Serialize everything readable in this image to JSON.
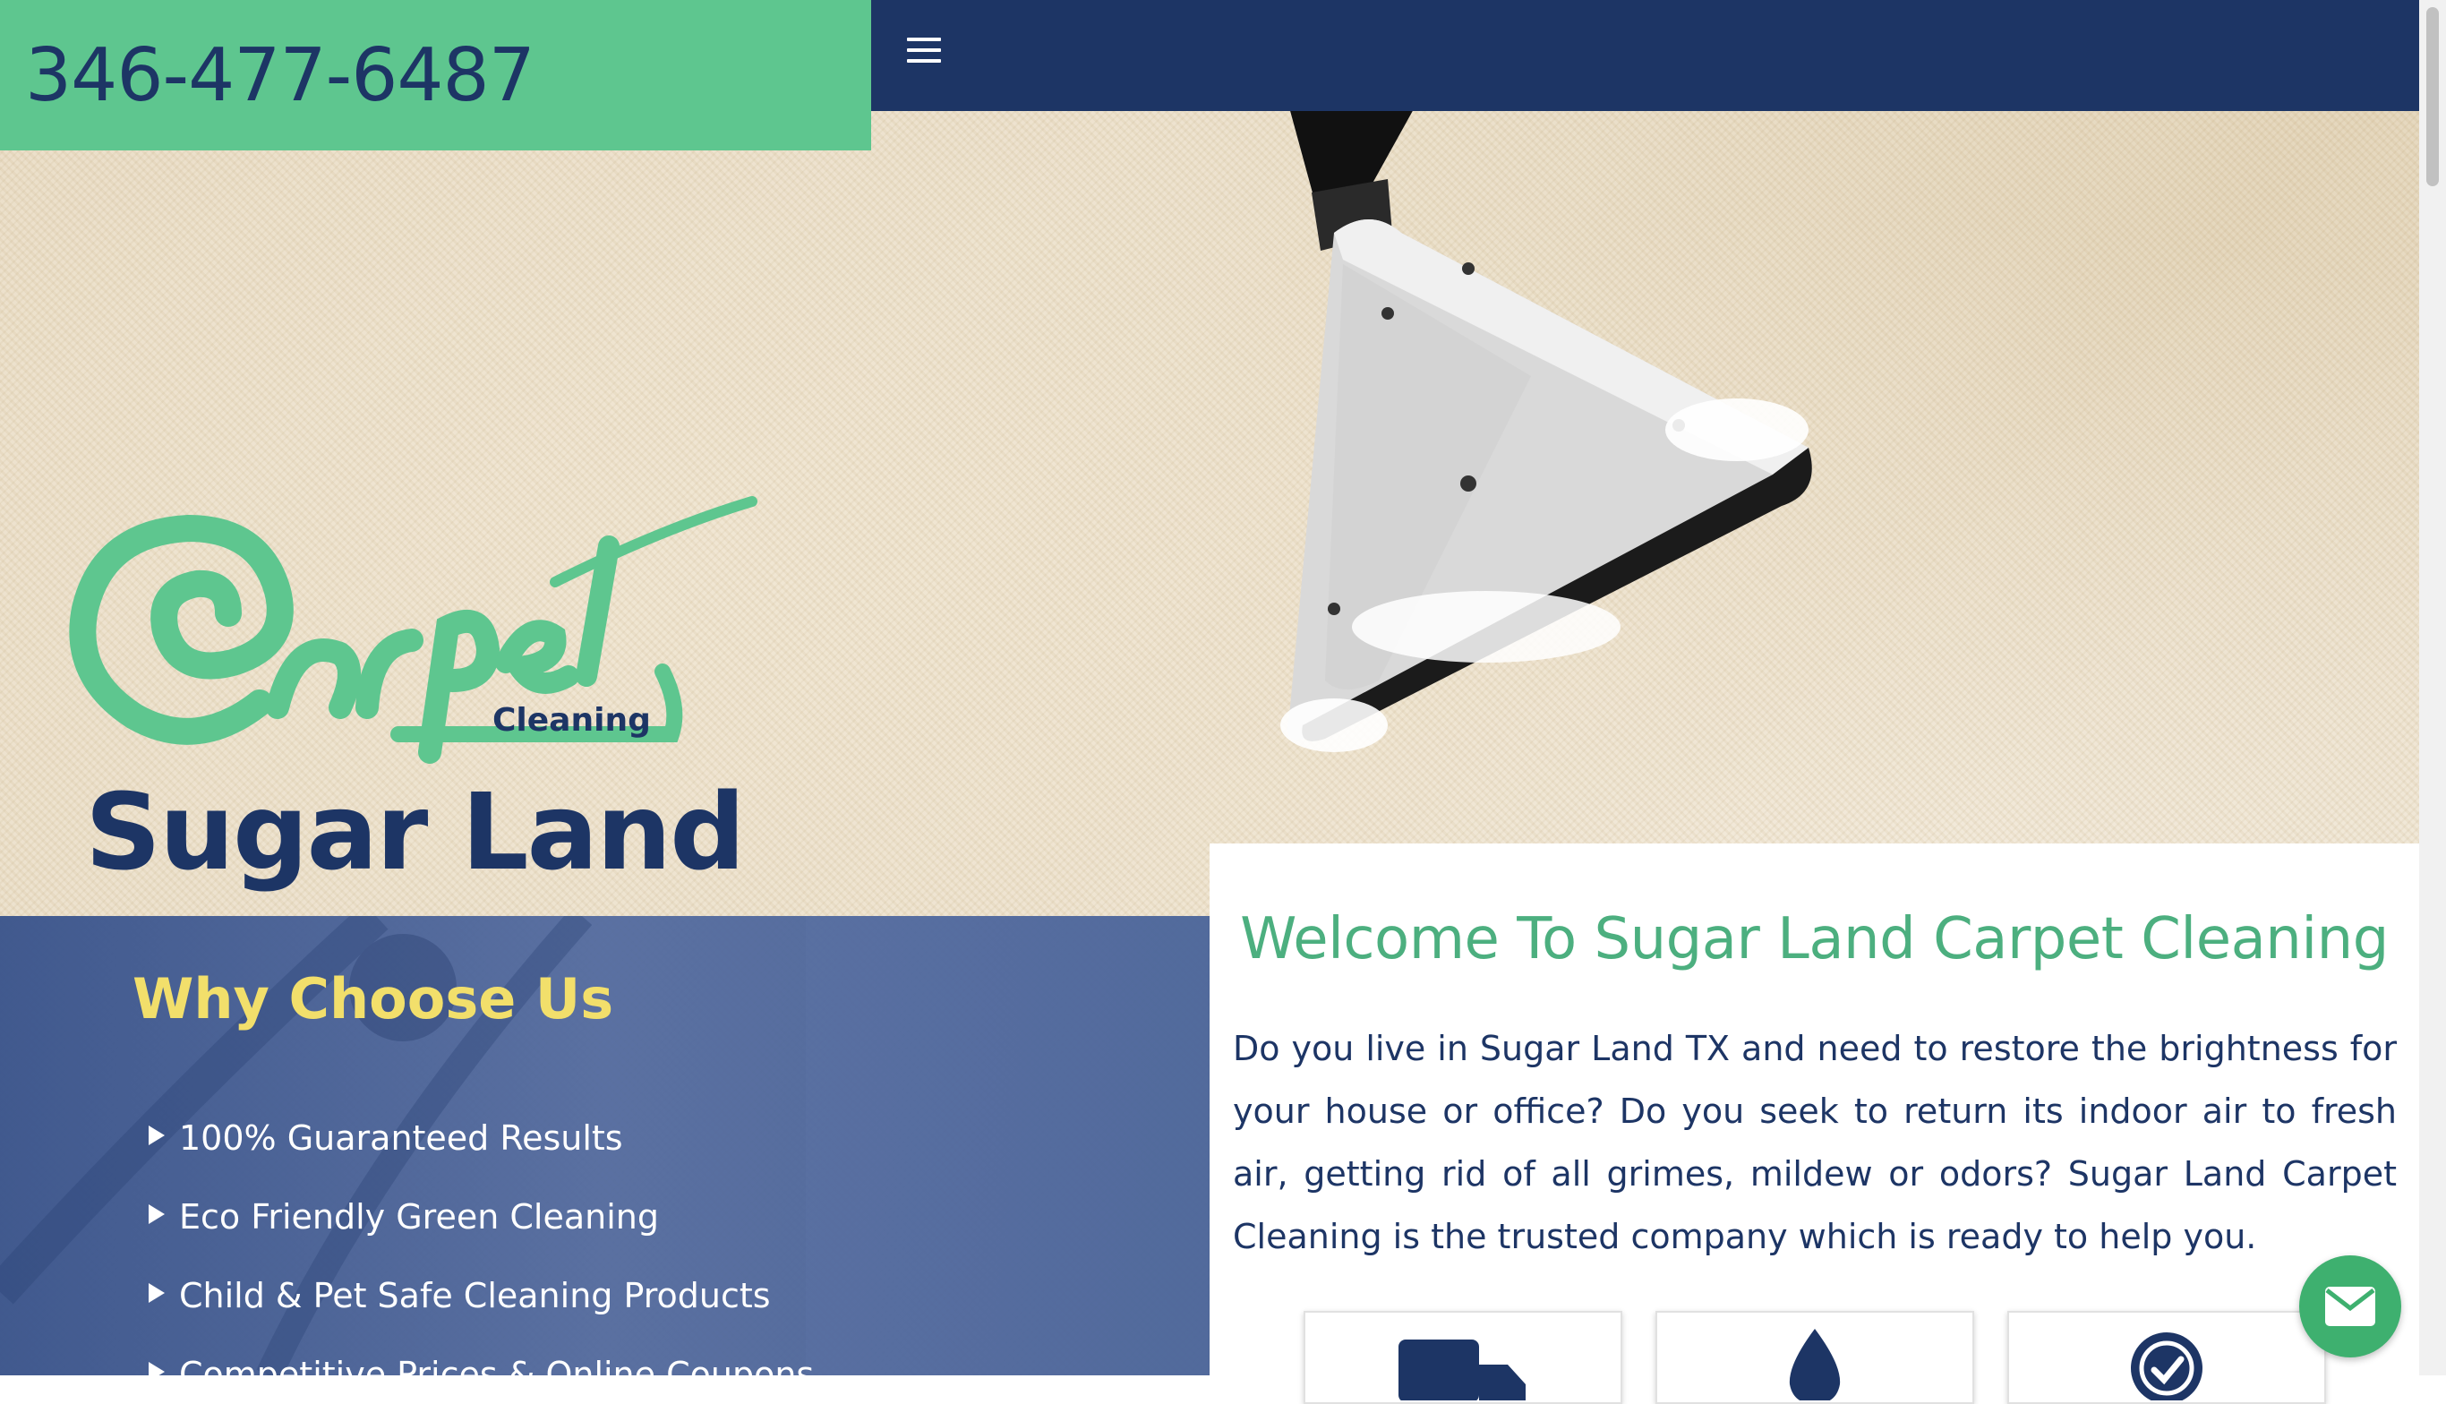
{
  "header": {
    "phone": "346-477-6487",
    "menu_icon": "hamburger-menu-icon"
  },
  "logo": {
    "script_word": "Carpet",
    "small_word": "Cleaning",
    "city": "Sugar Land"
  },
  "why_choose": {
    "title": "Why Choose Us",
    "items": [
      "100% Guaranteed Results",
      "Eco Friendly Green Cleaning",
      "Child & Pet Safe Cleaning Products",
      "Competitive Prices & Online Coupons"
    ]
  },
  "welcome": {
    "title": "Welcome To Sugar Land Carpet Cleaning",
    "body": "Do you live in Sugar Land TX and need to restore the brightness for your house or office? Do you seek to return its indoor air to fresh air, getting rid of all grimes, mildew or odors? Sugar Land Carpet Cleaning is the trusted company which is ready to help you."
  },
  "features": [
    {
      "icon": "truck-icon"
    },
    {
      "icon": "water-drop-icon"
    },
    {
      "icon": "badge-check-icon"
    }
  ],
  "colors": {
    "navy": "#1d3565",
    "green": "#5ec68f",
    "accent_green": "#4caf7f",
    "yellow": "#f2df6b"
  },
  "chat": {
    "icon": "envelope-icon"
  }
}
